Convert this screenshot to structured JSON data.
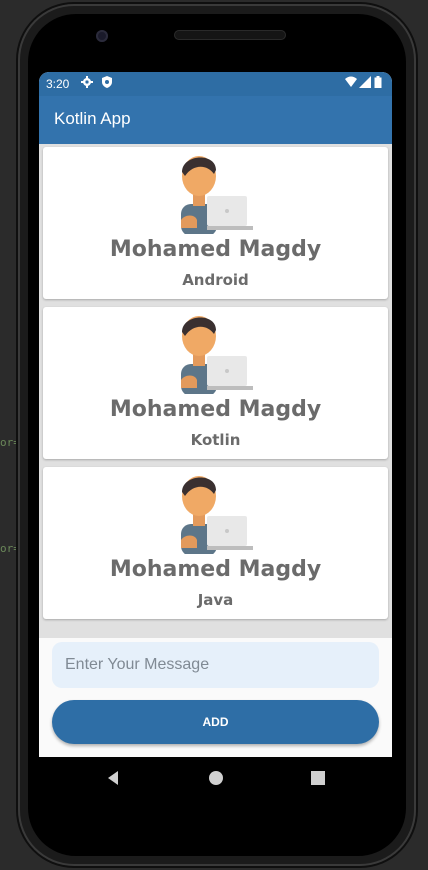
{
  "ide": {
    "snippets": [
      "or=",
      "or="
    ]
  },
  "status_bar": {
    "time": "3:20",
    "icons": [
      "gear-icon",
      "shield-icon",
      "wifi-icon",
      "signal-icon",
      "battery-icon"
    ]
  },
  "app_bar": {
    "title": "Kotlin App"
  },
  "cards": [
    {
      "name": "Mohamed Magdy",
      "language": "Android"
    },
    {
      "name": "Mohamed Magdy",
      "language": "Kotlin"
    },
    {
      "name": "Mohamed Magdy",
      "language": "Java"
    }
  ],
  "composer": {
    "placeholder": "Enter Your Message",
    "value": "",
    "add_label": "ADD"
  },
  "nav": {
    "buttons": [
      "back-icon",
      "home-icon",
      "recents-icon"
    ]
  },
  "colors": {
    "primary": "#3373ad",
    "primary_dark": "#2e6da4",
    "input_bg": "#e6f0fa",
    "card_text": "#6b6b6b"
  }
}
